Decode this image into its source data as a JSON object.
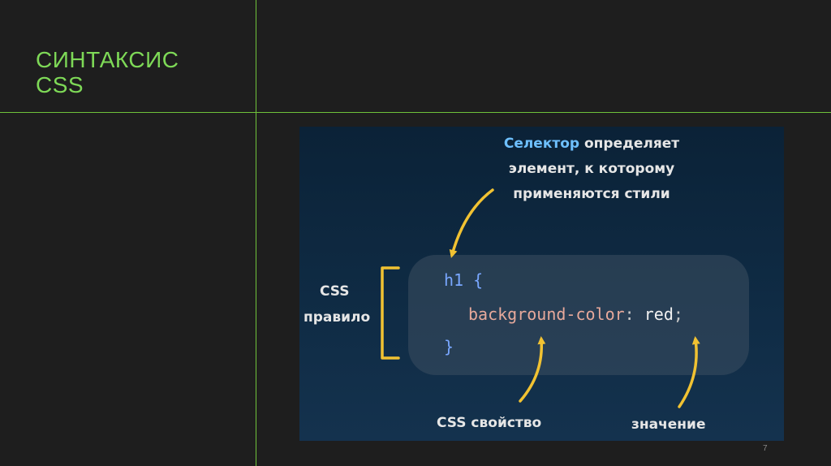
{
  "slide": {
    "title_line1": "СИНТАКСИС",
    "title_line2": "CSS",
    "number": "7"
  },
  "diagram": {
    "selector_word": "Селектор",
    "selector_rest": " определяет",
    "selector_line2": "элемент, к которому",
    "selector_line3": "применяются стили",
    "rule_label_line1": "CSS",
    "rule_label_line2": "правило",
    "property_label": "CSS свойство",
    "value_label": "значение",
    "code": {
      "selector": "h1",
      "open_brace": "{",
      "property": "background-color",
      "colon": ":",
      "value": "red",
      "semicolon": ";",
      "close_brace": "}"
    }
  },
  "colors": {
    "accent": "#7ed957",
    "line": "#6fc23a",
    "arrow": "#f1c232",
    "selector_highlight": "#6ec0ff"
  }
}
